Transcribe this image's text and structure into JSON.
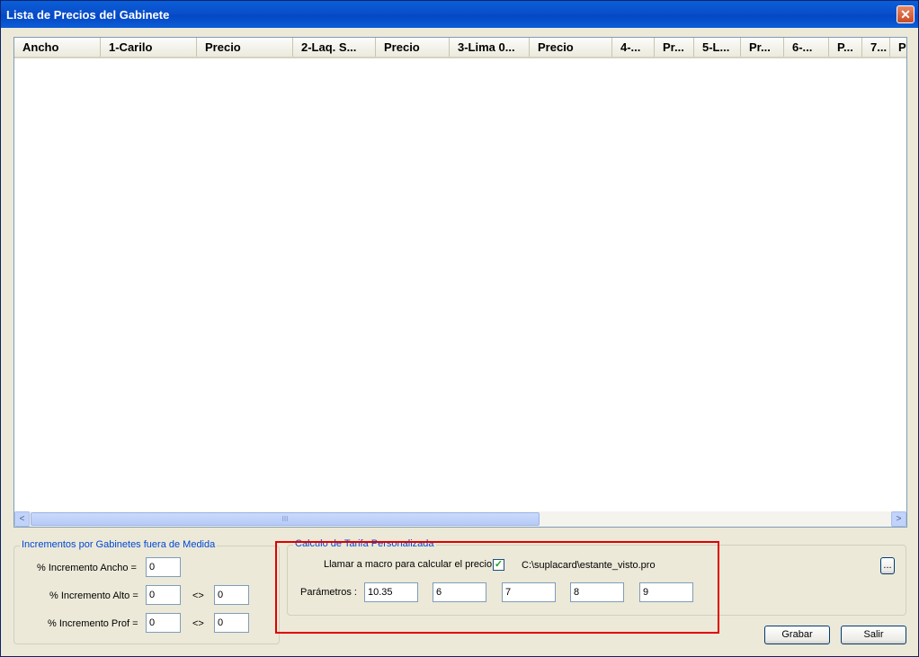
{
  "window": {
    "title": "Lista de Precios del Gabinete",
    "close_glyph": "✕"
  },
  "grid": {
    "columns": [
      "Ancho",
      "1-Carilo",
      "Precio",
      "2-Laq. S...",
      "Precio",
      "3-Lima 0...",
      "Precio",
      "4-...",
      "Pr...",
      "5-L...",
      "Pr...",
      "6-...",
      "P...",
      "7...",
      "P"
    ],
    "scroll_left": "<",
    "scroll_right": ">",
    "thumb_grip": "III"
  },
  "increments": {
    "title": "Incrementos por Gabinetes fuera de Medida",
    "ancho_label": "% Incremento Ancho =",
    "ancho_value": "0",
    "alto_label": "% Incremento Alto =",
    "alto_value": "0",
    "alto_sep": "<>",
    "alto_value2": "0",
    "prof_label": "% Incremento Prof =",
    "prof_value": "0",
    "prof_sep": "<>",
    "prof_value2": "0"
  },
  "tarifa": {
    "title": "Calculo de Tarifa Personalizada",
    "macro_label": "Llamar a macro para calcular el precio :",
    "macro_checked": true,
    "macro_path": "C:\\suplacard\\estante_visto.pro",
    "params_label": "Parámetros :",
    "params": [
      "10.35",
      "6",
      "7",
      "8",
      "9"
    ],
    "browse_label": "..."
  },
  "buttons": {
    "grabar": "Grabar",
    "salir": "Salir"
  },
  "colors": {
    "highlight_box": "#e00000"
  }
}
